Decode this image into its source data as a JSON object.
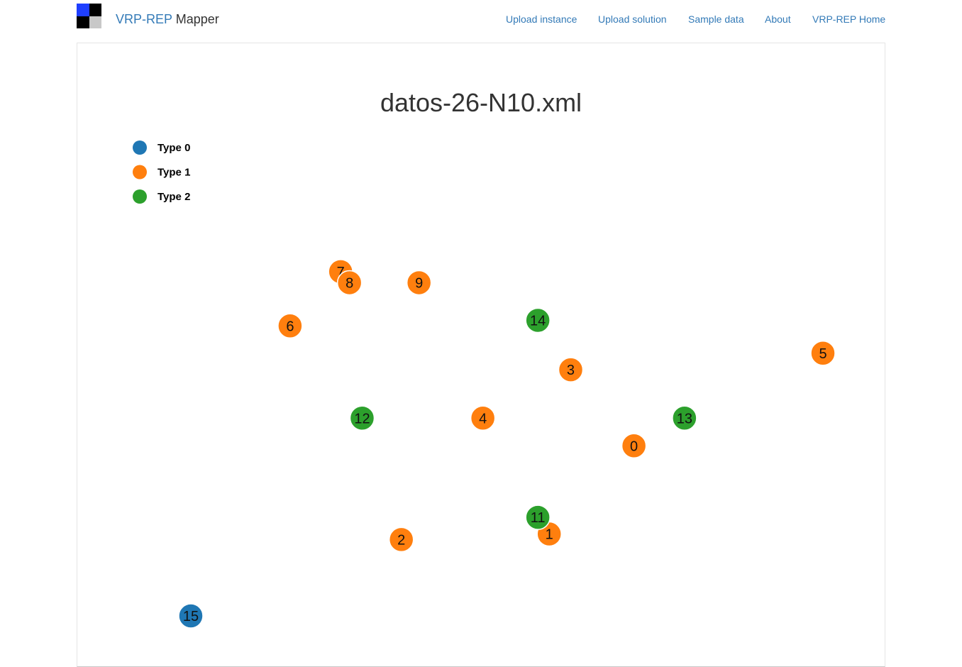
{
  "app": {
    "brand_part1": "VRP-REP",
    "brand_part2": "Mapper",
    "logo_colors": [
      "#1f3fff",
      "#000000",
      "#000000",
      "#c8c8c8"
    ],
    "link_color": "#337ab7",
    "text_color": "#333333"
  },
  "nav": {
    "items": [
      {
        "label": "Upload instance"
      },
      {
        "label": "Upload solution"
      },
      {
        "label": "Sample data"
      },
      {
        "label": "About"
      },
      {
        "label": "VRP-REP Home"
      }
    ]
  },
  "map": {
    "title": "datos-26-N10.xml",
    "legend": [
      {
        "label": "Type 0",
        "color": "#1f77b4"
      },
      {
        "label": "Type 1",
        "color": "#ff7f0e"
      },
      {
        "label": "Type 2",
        "color": "#2ca02c"
      }
    ]
  },
  "chart_data": {
    "type": "scatter",
    "title": "datos-26-N10.xml",
    "xlabel": "",
    "ylabel": "",
    "grid": false,
    "legend_position": "top-left",
    "xlim": [
      0,
      100
    ],
    "ylim": [
      0,
      100
    ],
    "series": [
      {
        "name": "Type 0",
        "color": "#1f77b4",
        "points": [
          {
            "id": "15",
            "x": 0,
            "y": 0
          }
        ]
      },
      {
        "name": "Type 1",
        "color": "#ff7f0e",
        "points": [
          {
            "id": "0",
            "x": 70.1,
            "y": 46.1
          },
          {
            "id": "1",
            "x": 56.7,
            "y": 22.2
          },
          {
            "id": "2",
            "x": 33.3,
            "y": 20.7
          },
          {
            "id": "3",
            "x": 60.1,
            "y": 66.7
          },
          {
            "id": "4",
            "x": 46.2,
            "y": 53.6
          },
          {
            "id": "5",
            "x": 100,
            "y": 71.2
          },
          {
            "id": "6",
            "x": 15.7,
            "y": 78.6
          },
          {
            "id": "7",
            "x": 23.7,
            "y": 93.3
          },
          {
            "id": "8",
            "x": 25.1,
            "y": 90.3
          },
          {
            "id": "9",
            "x": 36.1,
            "y": 90.3
          }
        ]
      },
      {
        "name": "Type 2",
        "color": "#2ca02c",
        "points": [
          {
            "id": "11",
            "x": 54.9,
            "y": 26.7
          },
          {
            "id": "12",
            "x": 27.1,
            "y": 53.6
          },
          {
            "id": "13",
            "x": 78.1,
            "y": 53.6
          },
          {
            "id": "14",
            "x": 54.9,
            "y": 80.1
          }
        ]
      }
    ]
  }
}
